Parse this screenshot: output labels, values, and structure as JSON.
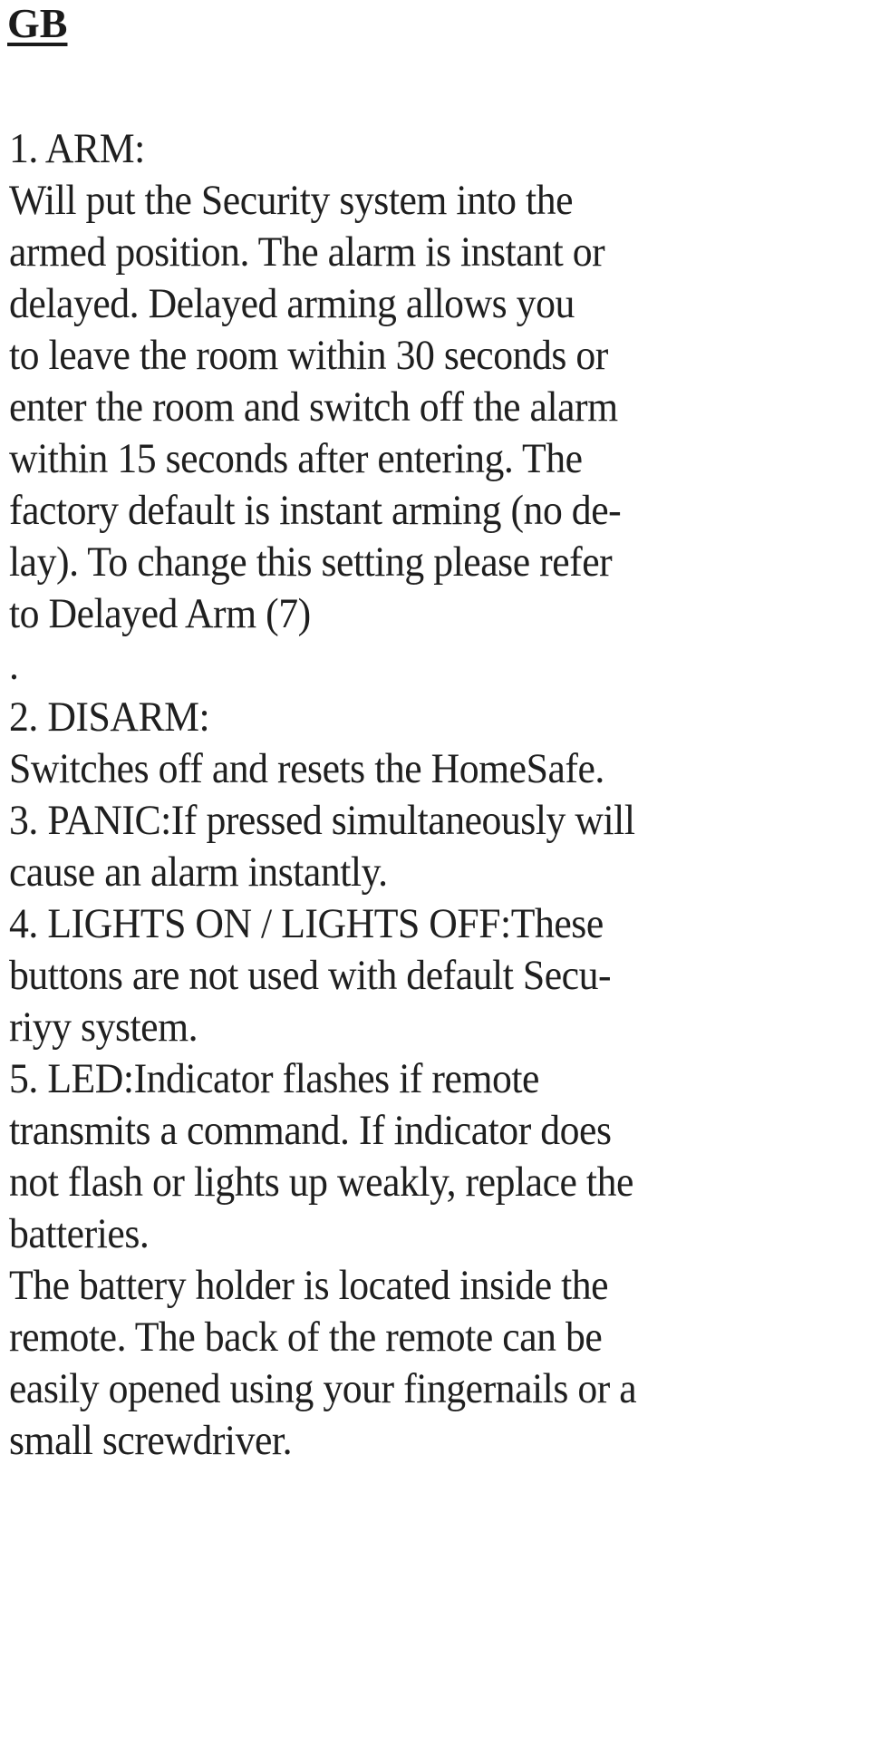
{
  "document": {
    "heading": "GB",
    "lines": [
      "1. ARM:",
      "Will put the Security system into the",
      "armed position. The alarm is instant or",
      "delayed. Delayed arming allows you",
      "to leave the room within 30 seconds or",
      "enter the room and switch off the alarm",
      "within 15 seconds after entering. The",
      "factory default is instant arming (no de-",
      "lay). To change this setting please refer",
      "to Delayed Arm (7)",
      ".",
      "2. DISARM:",
      "Switches off and resets the HomeSafe.",
      "3. PANIC:If pressed simultaneously will",
      "cause an alarm instantly.",
      "4. LIGHTS ON / LIGHTS OFF:These",
      "buttons are not used with default Secu-",
      "riyy system.",
      "5. LED:Indicator flashes if remote",
      "transmits a command. If indicator does",
      "not flash or lights up weakly, replace the",
      "batteries.",
      "The battery holder is located inside the",
      "remote. The back of the remote can be",
      "easily opened using your fingernails or a",
      "small screwdriver."
    ]
  }
}
